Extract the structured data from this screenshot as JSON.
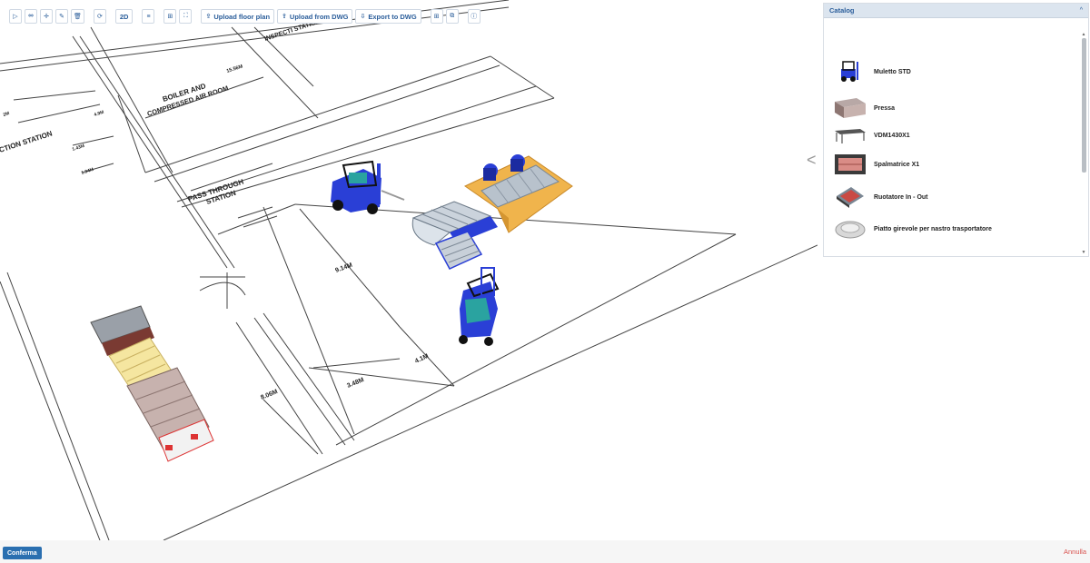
{
  "toolbar": {
    "tools": [
      {
        "icon": "select-pointer-icon",
        "glyph": "▷"
      },
      {
        "icon": "pan-icon",
        "glyph": "⤄"
      },
      {
        "icon": "move-icon",
        "glyph": "✛"
      },
      {
        "icon": "edit-pencil-icon",
        "glyph": "✎"
      },
      {
        "icon": "delete-trash-icon",
        "glyph": "🗑"
      }
    ],
    "rotate_icon": "⟳",
    "view_mode_label": "2D",
    "layers_icon": "≡",
    "grid_icon": "⊞",
    "fullscreen_icon": "⛶",
    "upload_floor_plan_label": "Upload floor plan",
    "upload_dwg_label": "Upload from DWG",
    "export_dwg_label": "Export to DWG",
    "upload_glyph": "⇪",
    "download_glyph": "⇩",
    "expand_icon": "⊞",
    "layers2_icon": "⧉",
    "info_icon": "ⓘ"
  },
  "floor_plan_labels": {
    "inspection": "INSPECTI STATION",
    "boiler": "BOILER AND",
    "compressed": "COMPRESSED AIR ROOM",
    "boiler_dim": "15.56M",
    "section": "CTION STATION",
    "pass_through": "PASS THROUGH",
    "station": "STATION",
    "dim_914": "9.14M",
    "dim_41": "4.1M",
    "dim_348": "3.48M",
    "dim_806": "8.06M",
    "dim_143": "1.43M",
    "dim_134": "1.34M",
    "dim_49": "4.9M",
    "dim_2m": "2M"
  },
  "catalog": {
    "title": "Catalog",
    "collapse_glyph": "^",
    "items": [
      {
        "label": "Muletto STD",
        "icon": "forklift-icon"
      },
      {
        "label": "Pressa",
        "icon": "press-machine-icon"
      },
      {
        "label": "VDM1430X1",
        "icon": "table-machine-icon"
      },
      {
        "label": "Spalmatrice X1",
        "icon": "spreader-machine-icon"
      },
      {
        "label": "Ruotatore In - Out",
        "icon": "rotator-icon"
      },
      {
        "label": "Piatto girevole per nastro trasportatore",
        "icon": "turntable-icon"
      }
    ]
  },
  "side_toggle_glyph": "<",
  "footer": {
    "confirm_label": "Conferma",
    "cancel_label": "Annulla"
  },
  "colors": {
    "accent": "#2a5d9a",
    "primary_button": "#2a6fb0",
    "cancel": "#d9534f",
    "forklift": "#2a3fd6",
    "conveyor_orange": "#f0b44c"
  }
}
